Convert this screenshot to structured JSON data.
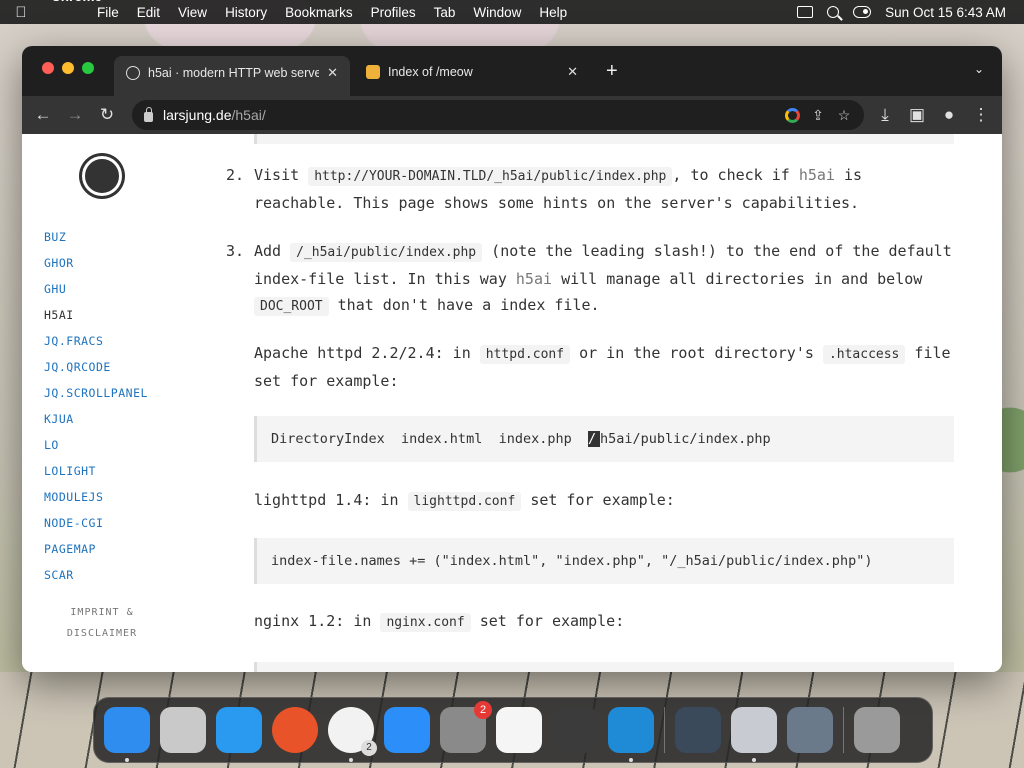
{
  "menubar": {
    "app_name": "Chrome",
    "items": [
      "File",
      "Edit",
      "View",
      "History",
      "Bookmarks",
      "Profiles",
      "Tab",
      "Window",
      "Help"
    ],
    "datetime": "Sun Oct 15  6:43 AM"
  },
  "tabs": [
    {
      "title": "h5ai · modern HTTP web serve",
      "active": true
    },
    {
      "title": "Index of /meow",
      "active": false
    }
  ],
  "address": {
    "host": "larsjung.de",
    "path": "/h5ai/"
  },
  "sidebar": {
    "items": [
      {
        "label": "BUZ"
      },
      {
        "label": "GHOR"
      },
      {
        "label": "GHU"
      },
      {
        "label": "H5AI"
      },
      {
        "label": "JQ.FRACS"
      },
      {
        "label": "JQ.QRCODE"
      },
      {
        "label": "JQ.SCROLLPANEL"
      },
      {
        "label": "KJUA"
      },
      {
        "label": "LO"
      },
      {
        "label": "LOLIGHT"
      },
      {
        "label": "MODULEJS"
      },
      {
        "label": "NODE-CGI"
      },
      {
        "label": "PAGEMAP"
      },
      {
        "label": "SCAR"
      }
    ],
    "imprint_line1": "IMPRINT &",
    "imprint_line2": "DISCLAIMER"
  },
  "content": {
    "step2": {
      "num": "2.",
      "pre": "Visit",
      "code": "http://YOUR-DOMAIN.TLD/_h5ai/public/index.php",
      "mid": ", to check if",
      "name": "h5ai",
      "post": "is",
      "line2": "reachable. This page shows some hints on the server's capabilities."
    },
    "step3": {
      "num": "3.",
      "pre": "Add",
      "code1": "/_h5ai/public/index.php",
      "mid1": "(note the leading slash!) to the end of the default",
      "line2_pre": "index-file list. In this way",
      "name": "h5ai",
      "line2_post": "will manage all directories in and below",
      "code2": "DOC_ROOT",
      "line3_post": "that don't have a index file."
    },
    "apache": {
      "pre": "Apache httpd 2.2/2.4: in",
      "code1": "httpd.conf",
      "mid": "or in the root directory's",
      "code2": ".htaccess",
      "post": "file",
      "line2": "set for example:"
    },
    "apache_code_pre": "DirectoryIndex  index.html  index.php  ",
    "apache_code_sel": "/",
    "apache_code_post": "h5ai/public/index.php",
    "lighttpd": {
      "pre": "lighttpd 1.4: in",
      "code": "lighttpd.conf",
      "post": "set for example:"
    },
    "lighttpd_code": "index-file.names += (\"index.html\", \"index.php\", \"/_h5ai/public/index.php\")",
    "nginx": {
      "pre": "nginx 1.2: in",
      "code": "nginx.conf",
      "post": "set for example:"
    }
  },
  "dock": {
    "apps": [
      {
        "name": "Finder",
        "color": "#2f8df0"
      },
      {
        "name": "Launchpad",
        "color": "#c9c9c9"
      },
      {
        "name": "Safari",
        "color": "#2a9af0"
      },
      {
        "name": "Firefox",
        "color": "#e8532a"
      },
      {
        "name": "Chrome",
        "color": "#f2f2f2",
        "badge": "2"
      },
      {
        "name": "App Store",
        "color": "#2c8ef8"
      },
      {
        "name": "System Preferences",
        "color": "#8a8a8a",
        "badge": "2"
      },
      {
        "name": "TextEdit",
        "color": "#f5f5f5"
      },
      {
        "name": "Instruments",
        "color": "#3b3b3b"
      },
      {
        "name": "VS Code",
        "color": "#1f8ad6"
      },
      {
        "name": "Nox",
        "color": "#3a4a5a"
      },
      {
        "name": "Settings",
        "color": "#c8ccd2"
      },
      {
        "name": "QuickTime",
        "color": "#6a7a8a"
      },
      {
        "name": "Trash",
        "color": "#9a9a9a"
      }
    ]
  }
}
